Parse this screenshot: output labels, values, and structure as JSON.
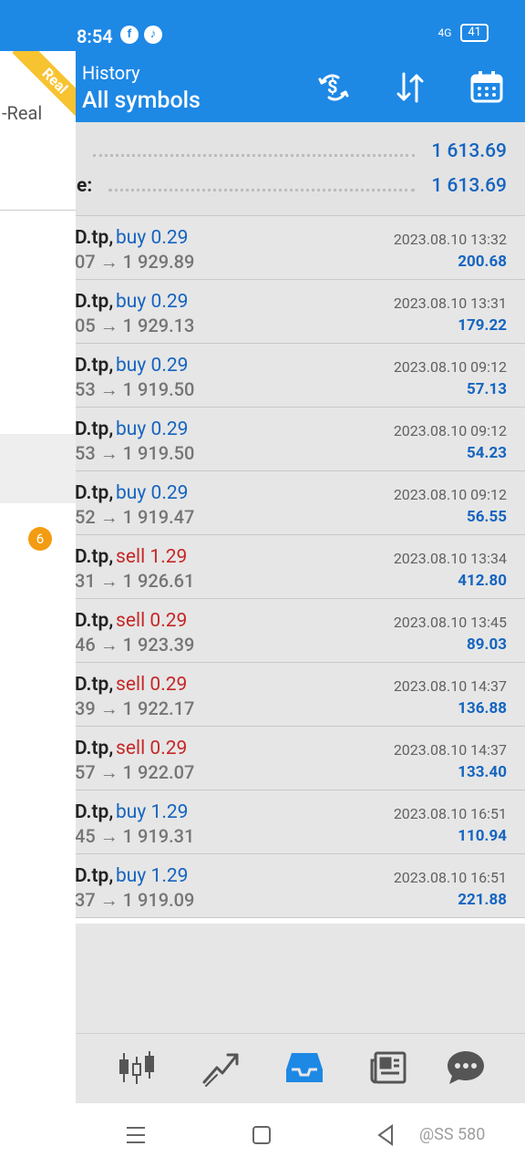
{
  "status_bar": {
    "time": "8:54",
    "app_icons": [
      "facebook-icon",
      "tiktok-icon"
    ],
    "network": "4G",
    "battery": "41"
  },
  "header": {
    "subtitle": "History",
    "title": "All symbols",
    "icons": [
      "currency-exchange-icon",
      "sort-icon",
      "calendar-icon"
    ]
  },
  "drawer": {
    "account_suffix": "-Real",
    "ribbon": "Real",
    "badge": "6"
  },
  "summary": {
    "row1": {
      "label": "",
      "value": "1 613.69"
    },
    "row2": {
      "label": "e:",
      "value": "1 613.69"
    }
  },
  "trades": [
    {
      "symbol": "D.tp,",
      "direction": "buy 0.29",
      "type": "buy",
      "price": "07 → 1 929.89",
      "date": "2023.08.10 13:32",
      "profit": "200.68"
    },
    {
      "symbol": "D.tp,",
      "direction": "buy 0.29",
      "type": "buy",
      "price": "05 → 1 929.13",
      "date": "2023.08.10 13:31",
      "profit": "179.22"
    },
    {
      "symbol": "D.tp,",
      "direction": "buy 0.29",
      "type": "buy",
      "price": "53 → 1 919.50",
      "date": "2023.08.10 09:12",
      "profit": "57.13"
    },
    {
      "symbol": "D.tp,",
      "direction": "buy 0.29",
      "type": "buy",
      "price": "53 → 1 919.50",
      "date": "2023.08.10 09:12",
      "profit": "54.23"
    },
    {
      "symbol": "D.tp,",
      "direction": "buy 0.29",
      "type": "buy",
      "price": "52 → 1 919.47",
      "date": "2023.08.10 09:12",
      "profit": "56.55"
    },
    {
      "symbol": "D.tp,",
      "direction": "sell 1.29",
      "type": "sell",
      "price": "31 → 1 926.61",
      "date": "2023.08.10 13:34",
      "profit": "412.80"
    },
    {
      "symbol": "D.tp,",
      "direction": "sell 0.29",
      "type": "sell",
      "price": "46 → 1 923.39",
      "date": "2023.08.10 13:45",
      "profit": "89.03"
    },
    {
      "symbol": "D.tp,",
      "direction": "sell 0.29",
      "type": "sell",
      "price": "39 → 1 922.17",
      "date": "2023.08.10 14:37",
      "profit": "136.88"
    },
    {
      "symbol": "D.tp,",
      "direction": "sell 0.29",
      "type": "sell",
      "price": "57 → 1 922.07",
      "date": "2023.08.10 14:37",
      "profit": "133.40"
    },
    {
      "symbol": "D.tp,",
      "direction": "buy 1.29",
      "type": "buy",
      "price": "45 → 1 919.31",
      "date": "2023.08.10 16:51",
      "profit": "110.94"
    },
    {
      "symbol": "D.tp,",
      "direction": "buy 1.29",
      "type": "buy",
      "price": "37 → 1 919.09",
      "date": "2023.08.10 16:51",
      "profit": "221.88"
    }
  ],
  "bottom_nav": [
    "quotes-icon",
    "chart-icon",
    "trade-history-icon",
    "news-icon",
    "chat-icon"
  ],
  "system_nav": {
    "icons": [
      "menu-icon",
      "home-icon",
      "back-icon"
    ],
    "watermark": "@SS 580"
  },
  "colors": {
    "accent": "#1e88e5",
    "buy": "#1565c0",
    "sell": "#c62828",
    "badge": "#f39c12",
    "ribbon": "#f7c331"
  }
}
